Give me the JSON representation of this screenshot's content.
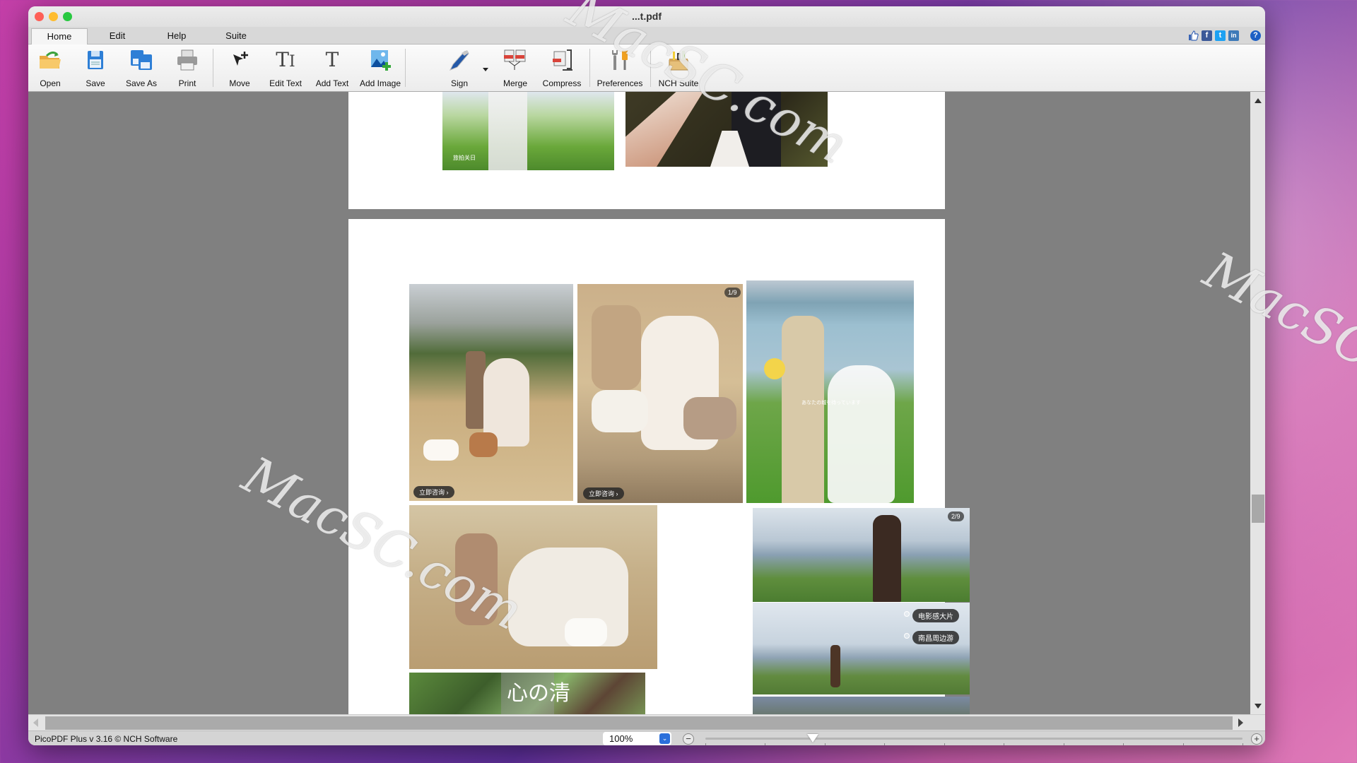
{
  "window": {
    "title": "...t.pdf",
    "tabs": [
      "Home",
      "Edit",
      "Help",
      "Suite"
    ],
    "active_tab": "Home",
    "social_icons": [
      "thumbs-up-icon",
      "facebook-icon",
      "twitter-icon",
      "linkedin-icon",
      "help-icon"
    ]
  },
  "toolbar": {
    "open": "Open",
    "save": "Save",
    "save_as": "Save As",
    "print": "Print",
    "move": "Move",
    "edit_text": "Edit Text",
    "add_text": "Add Text",
    "add_image": "Add Image",
    "sign": "Sign",
    "merge": "Merge",
    "compress": "Compress",
    "preferences": "Preferences",
    "nch_suite": "NCH Suite"
  },
  "document": {
    "page2": {
      "chip1": "立即咨询 ›",
      "chip2": "立即咨询 ›",
      "badge1": "1/9",
      "badge2": "2/9",
      "tag1": "电影感大片",
      "tag2": "南昌周边游",
      "photo_caption": "あなたの城を待っています",
      "bottom_text": "心の清"
    },
    "page1": {
      "photo_caption": "旅拍关日"
    }
  },
  "status": {
    "version_text": "PicoPDF Plus v 3.16 © NCH Software",
    "zoom_value": "100%",
    "zoom_slider_percent": 20
  },
  "watermark": {
    "text": "MacSC.com"
  },
  "colors": {
    "canvas_gray": "#808080",
    "accent_blue": "#2a6fdb"
  }
}
